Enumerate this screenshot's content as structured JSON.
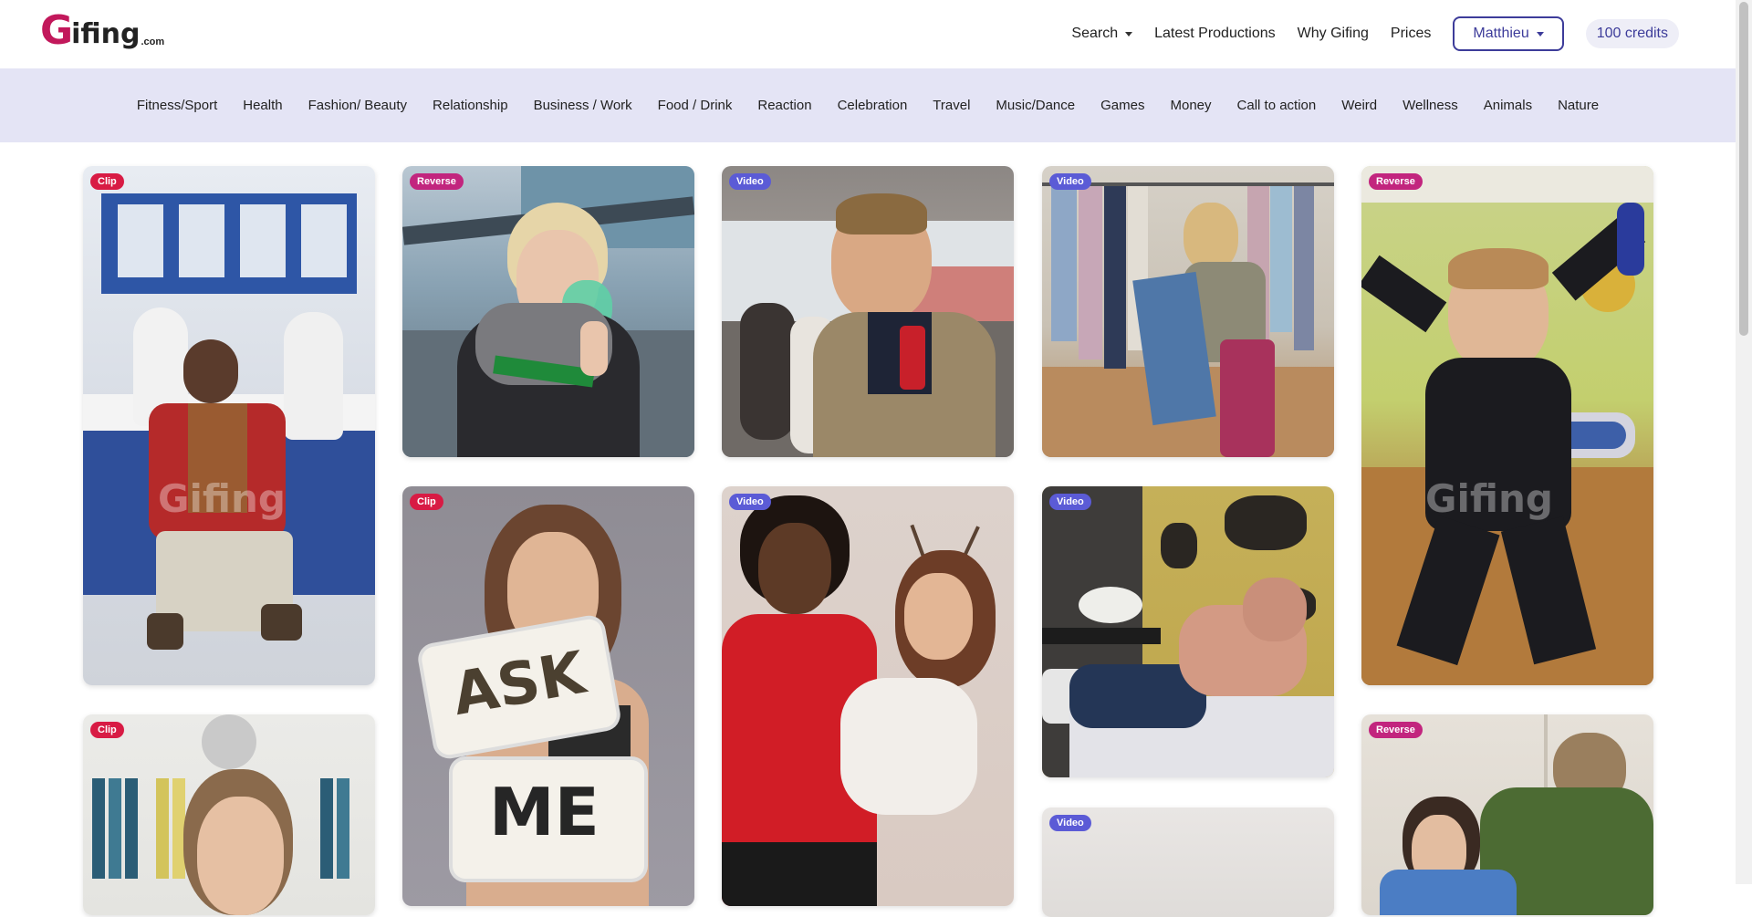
{
  "header": {
    "logo_g": "G",
    "logo_rest": "ifing",
    "logo_com": ".com",
    "nav": {
      "search": "Search",
      "latest": "Latest Productions",
      "why": "Why Gifing",
      "prices": "Prices"
    },
    "user": "Matthieu",
    "credits": "100 credits"
  },
  "categories": [
    "Fitness/Sport",
    "Health",
    "Fashion/ Beauty",
    "Relationship",
    "Business / Work",
    "Food / Drink",
    "Reaction",
    "Celebration",
    "Travel",
    "Music/Dance",
    "Games",
    "Money",
    "Call to action",
    "Weird",
    "Wellness",
    "Animals",
    "Nature"
  ],
  "cards": [
    {
      "badge": "Clip"
    },
    {
      "badge": "Reverse"
    },
    {
      "badge": "Video"
    },
    {
      "badge": "Video"
    },
    {
      "badge": "Reverse"
    },
    {
      "badge": "Clip"
    },
    {
      "badge": "Video"
    },
    {
      "badge": "Video"
    },
    {
      "badge": "Clip"
    },
    {
      "badge": "Video"
    },
    {
      "badge": "Reverse"
    }
  ],
  "sign": {
    "line1": "ASK",
    "line2": "ME"
  },
  "watermark": "Gifing"
}
